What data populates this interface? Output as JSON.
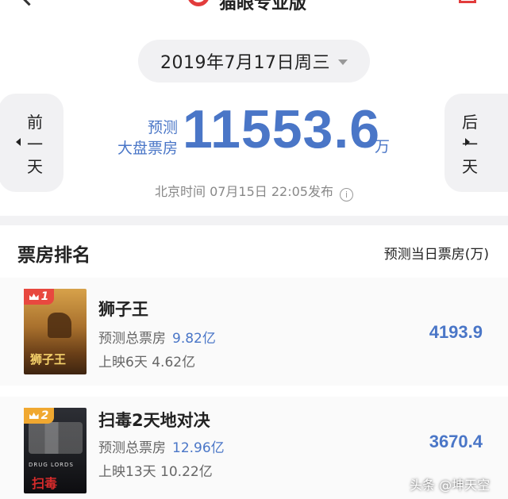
{
  "topbar": {
    "title": "猫眼专业版"
  },
  "header": {
    "date": "2019年7月17日周三",
    "prev_day": [
      "前",
      "一",
      "天"
    ],
    "next_day": [
      "后",
      "一",
      "天"
    ],
    "pred_label_1": "预测",
    "pred_label_2": "大盘票房",
    "total_value": "11553.6",
    "unit": "万",
    "publish_info": "北京时间 07月15日 22:05发布"
  },
  "ranking": {
    "title": "票房排名",
    "column": "预测当日票房(万)",
    "rows": [
      {
        "rank": "1",
        "title": "狮子王",
        "poster_title": "狮子王",
        "total_label": "预测总票房",
        "total_value": "9.82亿",
        "released": "上映6天 4.62亿",
        "daily": "4193.9"
      },
      {
        "rank": "2",
        "title": "扫毒2天地对决",
        "poster_title": "扫毒",
        "poster_sub": "DRUG LORDS",
        "total_label": "预测总票房",
        "total_value": "12.96亿",
        "released": "上映13天 10.22亿",
        "daily": "3670.4"
      }
    ]
  },
  "colors": {
    "accent_blue": "#4a76c7",
    "rank1_badge": "#e8483f",
    "rank2_badge": "#f0a830",
    "brand_red": "#e23c3c"
  },
  "watermark": "头条 @坤天空"
}
